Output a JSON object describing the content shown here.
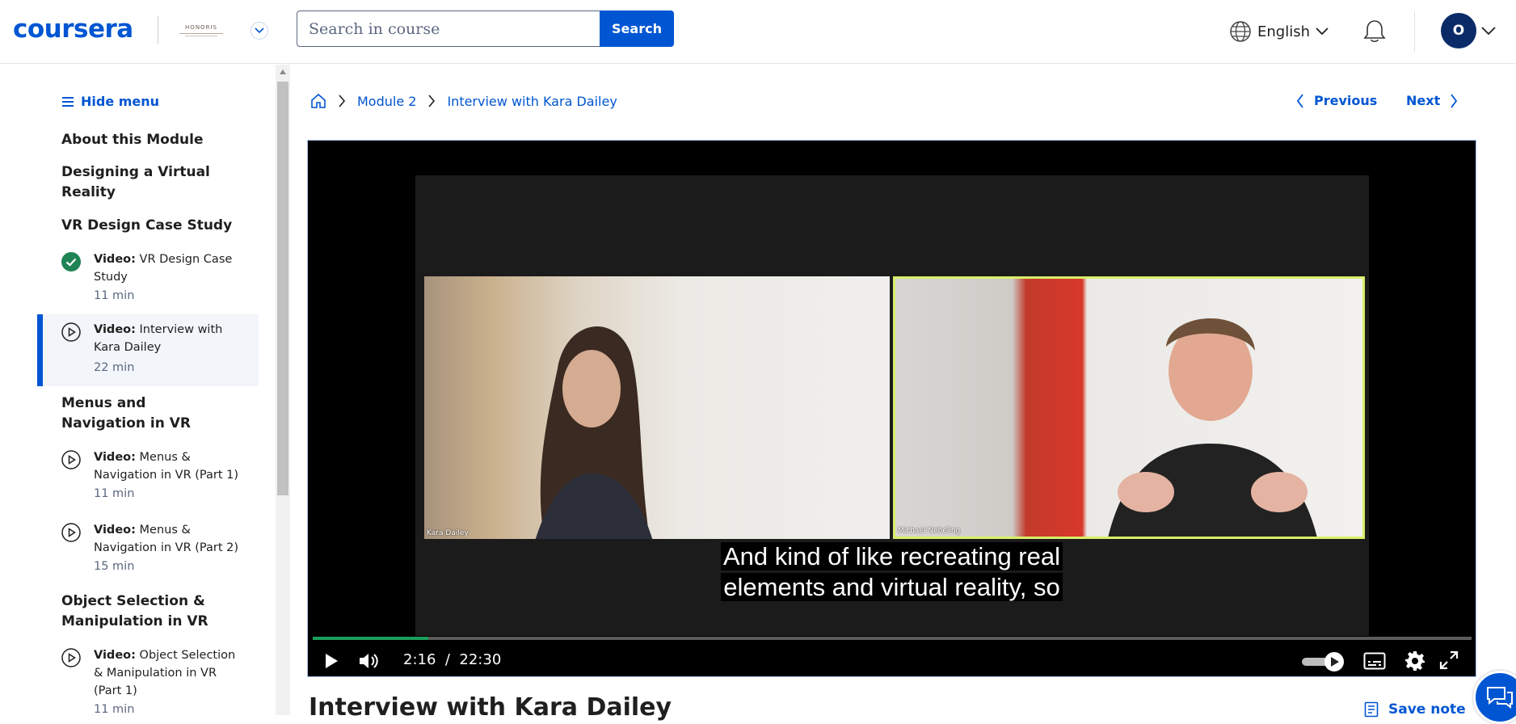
{
  "header": {
    "logo": "coursera",
    "partner_logo_text": "HONORIS",
    "search": {
      "placeholder": "Search in course",
      "value": "",
      "button_label": "Search"
    },
    "language": "English",
    "avatar_initial": "O"
  },
  "sidebar": {
    "hide_menu_label": "Hide menu",
    "sections": [
      {
        "title": "About this Module"
      },
      {
        "title": "Designing a Virtual Reality"
      },
      {
        "title": "VR Design Case Study"
      },
      {
        "title": "Menus and Navigation in VR"
      },
      {
        "title": "Object Selection & Manipulation in VR"
      }
    ],
    "items": [
      {
        "type": "Video:",
        "title": "VR Design Case Study",
        "duration": "11 min",
        "status": "completed"
      },
      {
        "type": "Video:",
        "title": "Interview with Kara Dailey",
        "duration": "22 min",
        "status": "active"
      },
      {
        "type": "Video:",
        "title": "Menus & Navigation in VR (Part 1)",
        "duration": "11 min",
        "status": "todo"
      },
      {
        "type": "Video:",
        "title": "Menus & Navigation in VR (Part 2)",
        "duration": "15 min",
        "status": "todo"
      },
      {
        "type": "Video:",
        "title": "Object Selection & Manipulation in VR (Part 1)",
        "duration": "11 min",
        "status": "todo"
      }
    ]
  },
  "breadcrumb": {
    "module": "Module 2",
    "current": "Interview with Kara Dailey"
  },
  "nav": {
    "previous": "Previous",
    "next": "Next"
  },
  "video": {
    "left_participant": "Kara Dailey",
    "right_participant": "Michael Nebeling",
    "caption_line1": "And kind of like recreating real",
    "caption_line2": "elements and virtual reality, so",
    "current_time": "2:16",
    "time_separator": "/",
    "duration": "22:30",
    "progress_fraction": 0.1
  },
  "page_title": "Interview with Kara Dailey",
  "save_note_label": "Save note",
  "colors": {
    "accent": "#0056d2",
    "completed": "#1f8354",
    "progress": "#1a9e5a"
  }
}
